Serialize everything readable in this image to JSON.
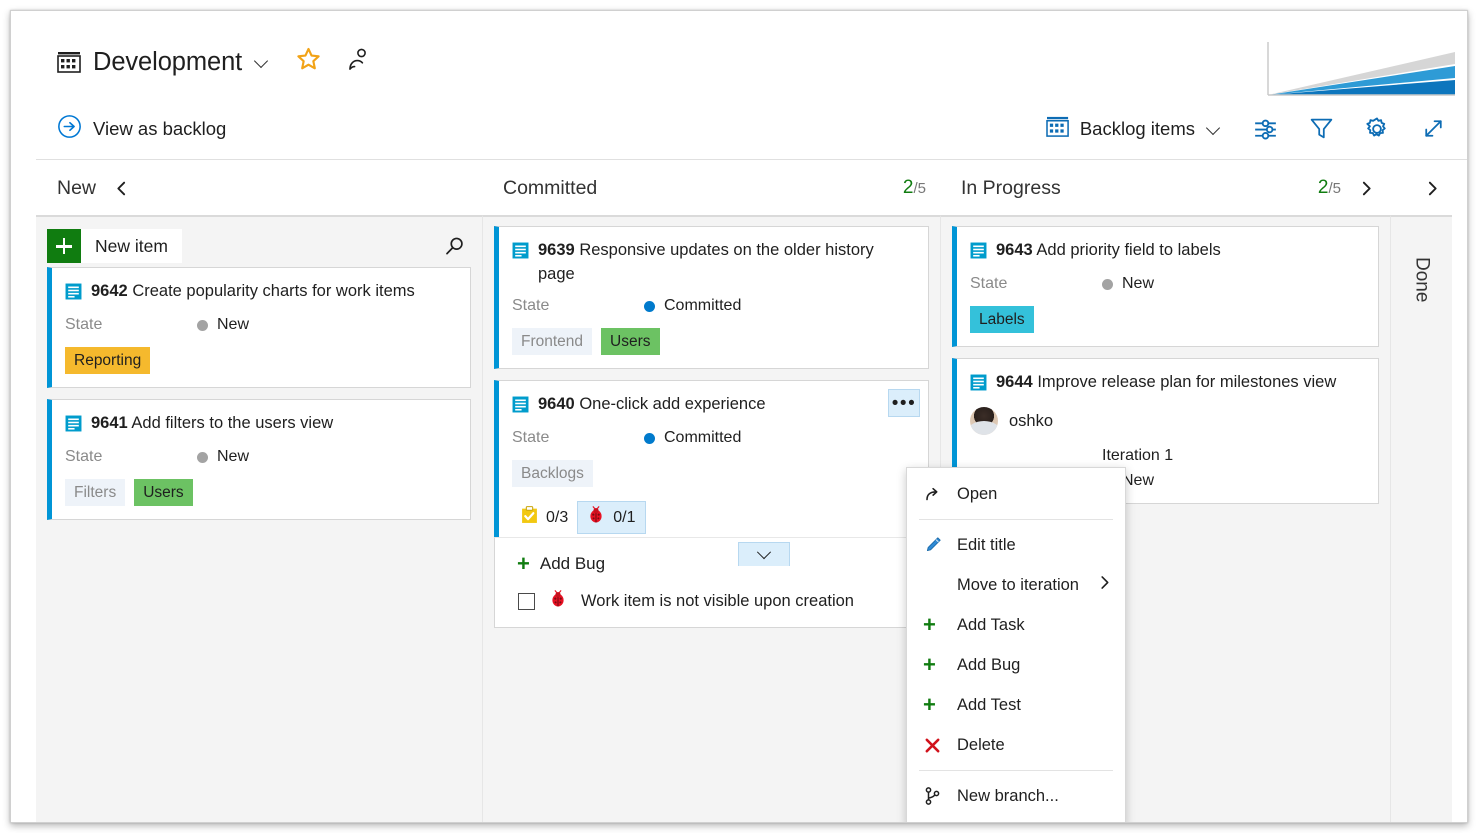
{
  "header": {
    "board_icon": "board-grid-icon",
    "title": "Development",
    "title_chevron": "chevron-down-icon",
    "favorite_icon": "star-icon",
    "team_icon": "people-icon",
    "chart_thumb_icon": "cumulative-flow-chart-thumbnail"
  },
  "toolbar": {
    "view_as_backlog": "View as backlog",
    "view_as_backlog_icon": "arrow-right-circle-icon",
    "pivot_icon": "backlog-grid-icon",
    "pivot_label": "Backlog items",
    "pivot_chevron": "chevron-down-icon",
    "settings_sliders_icon": "sliders-icon",
    "filter_icon": "funnel-icon",
    "gear_icon": "gear-icon",
    "fullscreen_icon": "expand-diagonal-icon"
  },
  "columns": [
    {
      "name": "New",
      "wip_current": "",
      "wip_limit": "",
      "collapse_icon": "chevron-left-icon",
      "new_item_label": "New item",
      "search_icon": "search-icon"
    },
    {
      "name": "Committed",
      "wip_current": "2",
      "wip_limit": "/5"
    },
    {
      "name": "In Progress",
      "wip_current": "2",
      "wip_limit": "/5",
      "collapse_icon": "chevron-right-icon"
    },
    {
      "name": "Done"
    }
  ],
  "cards": {
    "c9642": {
      "icon": "backlog-item-icon",
      "id": "9642",
      "title": "Create popularity charts for work items",
      "state_label": "State",
      "state_value": "New",
      "tags": [
        {
          "text": "Reporting",
          "style": "amber"
        }
      ]
    },
    "c9641": {
      "icon": "backlog-item-icon",
      "id": "9641",
      "title": "Add filters to the users view",
      "state_label": "State",
      "state_value": "New",
      "tags": [
        {
          "text": "Filters",
          "style": "plain"
        },
        {
          "text": "Users",
          "style": "green"
        }
      ]
    },
    "c9639": {
      "icon": "backlog-item-icon",
      "id": "9639",
      "title": "Responsive updates on the older history page",
      "state_label": "State",
      "state_value": "Committed",
      "tags": [
        {
          "text": "Frontend",
          "style": "plain"
        },
        {
          "text": "Users",
          "style": "green"
        }
      ]
    },
    "c9640": {
      "icon": "backlog-item-icon",
      "id": "9640",
      "title": "One-click add experience",
      "state_label": "State",
      "state_value": "Committed",
      "tags": [
        {
          "text": "Backlogs",
          "style": "plain"
        }
      ],
      "task_icon": "task-clipboard-icon",
      "task_count": "0/3",
      "bug_icon": "bug-ladybug-icon",
      "bug_count": "0/1",
      "expand_icon": "chevron-down-icon",
      "ellipsis_icon": "more-actions-icon",
      "add_child": {
        "add_bug_label": "Add Bug",
        "add_bug_icon": "plus-icon",
        "checkbox_icon": "checkbox-unchecked-icon",
        "child_bug_icon": "bug-ladybug-icon",
        "child_title": "Work item is not visible upon creation"
      }
    },
    "c9643": {
      "icon": "backlog-item-icon",
      "id": "9643",
      "title": "Add priority field to labels",
      "state_label": "State",
      "state_value": "New",
      "tags": [
        {
          "text": "Labels",
          "style": "cyan"
        }
      ]
    },
    "c9644": {
      "icon": "backlog-item-icon",
      "id": "9644",
      "title": "Improve release plan for milestones view",
      "avatar_icon": "user-avatar",
      "assignee": "oshko",
      "iteration": "Iteration 1",
      "state_value": "New"
    }
  },
  "context_menu": {
    "items": [
      {
        "label": "Open",
        "icon": "open-arrow-icon",
        "submenu": ""
      },
      {
        "label": "Edit title",
        "icon": "pencil-icon",
        "submenu": ""
      },
      {
        "label": "Move to iteration",
        "icon": "",
        "submenu": "chevron-right-icon"
      },
      {
        "label": "Add Task",
        "icon": "plus-icon",
        "submenu": ""
      },
      {
        "label": "Add Bug",
        "icon": "plus-icon",
        "submenu": ""
      },
      {
        "label": "Add Test",
        "icon": "plus-icon",
        "submenu": ""
      },
      {
        "label": "Delete",
        "icon": "x-icon",
        "submenu": ""
      },
      {
        "label": "New branch...",
        "icon": "branch-icon",
        "submenu": ""
      }
    ]
  },
  "colors": {
    "accent_blue": "#0095d6",
    "state_new_dot": "#a3a3a3",
    "state_committed_dot": "#007acc",
    "wip_green": "#107c10",
    "tag_amber": "#f5b92d",
    "tag_green": "#6cc263",
    "tag_cyan": "#34c1da",
    "tag_plain_bg": "#eef3f9",
    "bug_red": "#e81123",
    "task_yellow": "#f2c811"
  }
}
